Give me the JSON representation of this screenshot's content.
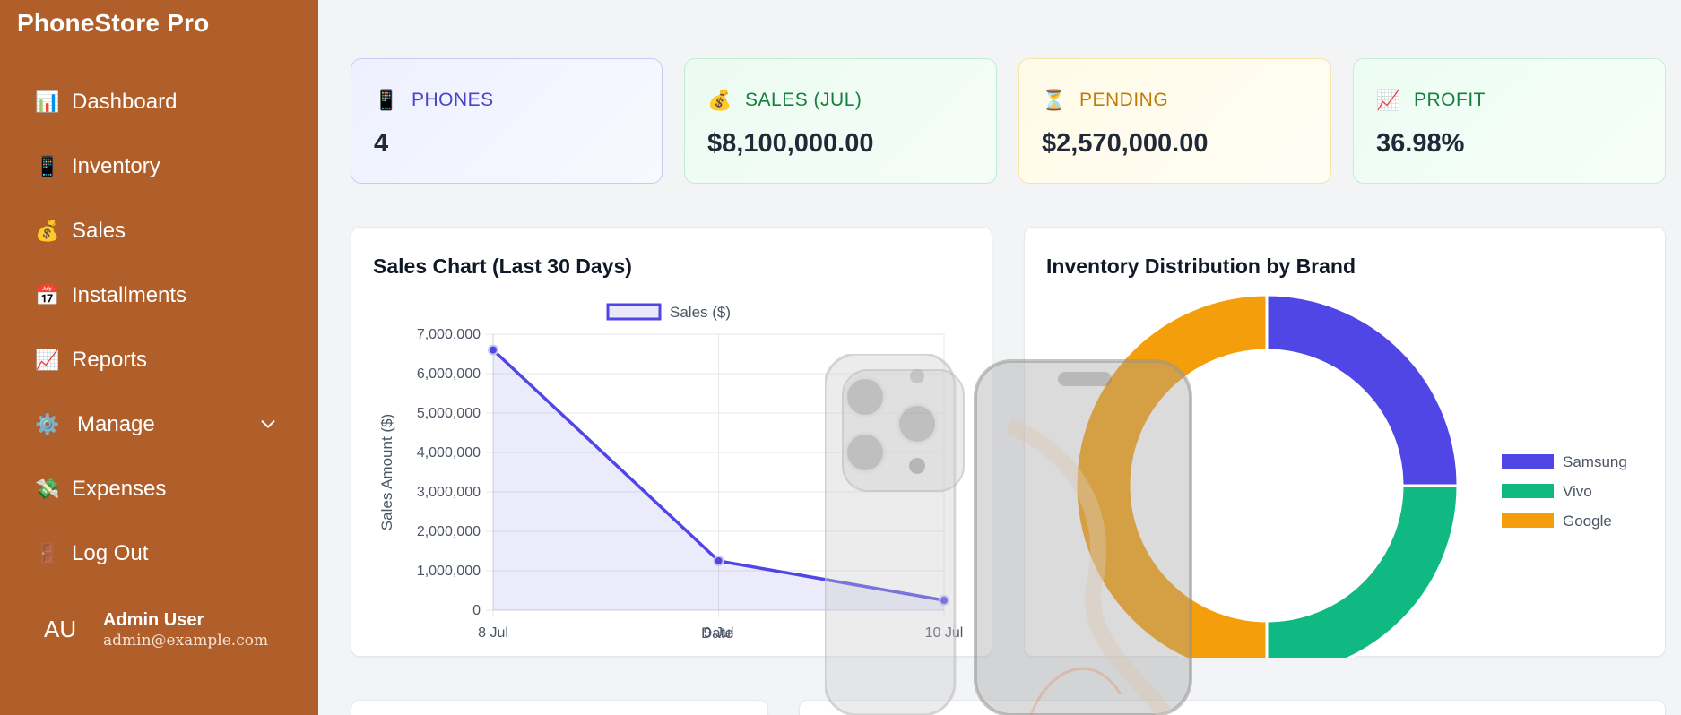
{
  "app": {
    "title": "PhoneStore Pro"
  },
  "sidebar": {
    "items": [
      {
        "label": "Dashboard",
        "icon": "bar-chart-icon",
        "glyph": "📊"
      },
      {
        "label": "Inventory",
        "icon": "phone-icon",
        "glyph": "📱"
      },
      {
        "label": "Sales",
        "icon": "money-bag-icon",
        "glyph": "💰"
      },
      {
        "label": "Installments",
        "icon": "calendar-icon",
        "glyph": "📅"
      },
      {
        "label": "Reports",
        "icon": "trend-chart-icon",
        "glyph": "📈"
      },
      {
        "label": "Manage",
        "icon": "gear-icon",
        "glyph": "⚙️"
      },
      {
        "label": "Expenses",
        "icon": "flying-money-icon",
        "glyph": "💸"
      },
      {
        "label": "Log Out",
        "icon": "door-icon",
        "glyph": "🚪"
      }
    ],
    "user": {
      "initials": "AU",
      "name": "Admin User",
      "email": "admin@example.com"
    }
  },
  "stats": [
    {
      "label": "PHONES",
      "value": "4",
      "icon": "phone-icon",
      "glyph": "📱"
    },
    {
      "label": "SALES (JUL)",
      "value": "$8,100,000.00",
      "icon": "money-bag-icon",
      "glyph": "💰"
    },
    {
      "label": "PENDING",
      "value": "$2,570,000.00",
      "icon": "hourglass-icon",
      "glyph": "⏳"
    },
    {
      "label": "PROFIT",
      "value": "36.98%",
      "icon": "trend-chart-icon",
      "glyph": "📈"
    }
  ],
  "panels": {
    "sales_title": "Sales Chart (Last 30 Days)",
    "inventory_title": "Inventory Distribution by Brand"
  },
  "colors": {
    "sidebar": "#b05e2a",
    "sales_line": "#4f46e5",
    "samsung": "#4f46e5",
    "vivo": "#10b981",
    "google": "#f59e0b"
  },
  "chart_data": [
    {
      "type": "line",
      "title": "",
      "xlabel": "Date",
      "ylabel": "Sales Amount ($)",
      "x": [
        "8 Jul",
        "9 Jul",
        "10 Jul"
      ],
      "series": [
        {
          "name": "Sales ($)",
          "values": [
            6600000,
            1250000,
            250000
          ]
        }
      ],
      "ylim": [
        0,
        7000000
      ],
      "yticks": [
        "0",
        "1,000,000",
        "2,000,000",
        "3,000,000",
        "4,000,000",
        "5,000,000",
        "6,000,000",
        "7,000,000"
      ],
      "grid": true,
      "legend": "top"
    },
    {
      "type": "pie",
      "title": "",
      "labels": [
        "Samsung",
        "Vivo",
        "Google"
      ],
      "values": [
        1,
        1,
        2
      ],
      "donut": true,
      "legend": "right"
    }
  ]
}
